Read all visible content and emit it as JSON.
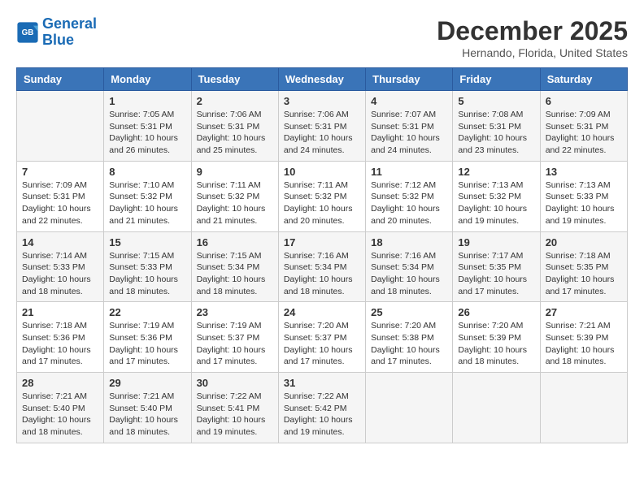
{
  "logo": {
    "line1": "General",
    "line2": "Blue"
  },
  "title": "December 2025",
  "subtitle": "Hernando, Florida, United States",
  "days_of_week": [
    "Sunday",
    "Monday",
    "Tuesday",
    "Wednesday",
    "Thursday",
    "Friday",
    "Saturday"
  ],
  "weeks": [
    [
      {
        "day": "",
        "content": ""
      },
      {
        "day": "1",
        "content": "Sunrise: 7:05 AM\nSunset: 5:31 PM\nDaylight: 10 hours\nand 26 minutes."
      },
      {
        "day": "2",
        "content": "Sunrise: 7:06 AM\nSunset: 5:31 PM\nDaylight: 10 hours\nand 25 minutes."
      },
      {
        "day": "3",
        "content": "Sunrise: 7:06 AM\nSunset: 5:31 PM\nDaylight: 10 hours\nand 24 minutes."
      },
      {
        "day": "4",
        "content": "Sunrise: 7:07 AM\nSunset: 5:31 PM\nDaylight: 10 hours\nand 24 minutes."
      },
      {
        "day": "5",
        "content": "Sunrise: 7:08 AM\nSunset: 5:31 PM\nDaylight: 10 hours\nand 23 minutes."
      },
      {
        "day": "6",
        "content": "Sunrise: 7:09 AM\nSunset: 5:31 PM\nDaylight: 10 hours\nand 22 minutes."
      }
    ],
    [
      {
        "day": "7",
        "content": "Sunrise: 7:09 AM\nSunset: 5:31 PM\nDaylight: 10 hours\nand 22 minutes."
      },
      {
        "day": "8",
        "content": "Sunrise: 7:10 AM\nSunset: 5:32 PM\nDaylight: 10 hours\nand 21 minutes."
      },
      {
        "day": "9",
        "content": "Sunrise: 7:11 AM\nSunset: 5:32 PM\nDaylight: 10 hours\nand 21 minutes."
      },
      {
        "day": "10",
        "content": "Sunrise: 7:11 AM\nSunset: 5:32 PM\nDaylight: 10 hours\nand 20 minutes."
      },
      {
        "day": "11",
        "content": "Sunrise: 7:12 AM\nSunset: 5:32 PM\nDaylight: 10 hours\nand 20 minutes."
      },
      {
        "day": "12",
        "content": "Sunrise: 7:13 AM\nSunset: 5:32 PM\nDaylight: 10 hours\nand 19 minutes."
      },
      {
        "day": "13",
        "content": "Sunrise: 7:13 AM\nSunset: 5:33 PM\nDaylight: 10 hours\nand 19 minutes."
      }
    ],
    [
      {
        "day": "14",
        "content": "Sunrise: 7:14 AM\nSunset: 5:33 PM\nDaylight: 10 hours\nand 18 minutes."
      },
      {
        "day": "15",
        "content": "Sunrise: 7:15 AM\nSunset: 5:33 PM\nDaylight: 10 hours\nand 18 minutes."
      },
      {
        "day": "16",
        "content": "Sunrise: 7:15 AM\nSunset: 5:34 PM\nDaylight: 10 hours\nand 18 minutes."
      },
      {
        "day": "17",
        "content": "Sunrise: 7:16 AM\nSunset: 5:34 PM\nDaylight: 10 hours\nand 18 minutes."
      },
      {
        "day": "18",
        "content": "Sunrise: 7:16 AM\nSunset: 5:34 PM\nDaylight: 10 hours\nand 18 minutes."
      },
      {
        "day": "19",
        "content": "Sunrise: 7:17 AM\nSunset: 5:35 PM\nDaylight: 10 hours\nand 17 minutes."
      },
      {
        "day": "20",
        "content": "Sunrise: 7:18 AM\nSunset: 5:35 PM\nDaylight: 10 hours\nand 17 minutes."
      }
    ],
    [
      {
        "day": "21",
        "content": "Sunrise: 7:18 AM\nSunset: 5:36 PM\nDaylight: 10 hours\nand 17 minutes."
      },
      {
        "day": "22",
        "content": "Sunrise: 7:19 AM\nSunset: 5:36 PM\nDaylight: 10 hours\nand 17 minutes."
      },
      {
        "day": "23",
        "content": "Sunrise: 7:19 AM\nSunset: 5:37 PM\nDaylight: 10 hours\nand 17 minutes."
      },
      {
        "day": "24",
        "content": "Sunrise: 7:20 AM\nSunset: 5:37 PM\nDaylight: 10 hours\nand 17 minutes."
      },
      {
        "day": "25",
        "content": "Sunrise: 7:20 AM\nSunset: 5:38 PM\nDaylight: 10 hours\nand 17 minutes."
      },
      {
        "day": "26",
        "content": "Sunrise: 7:20 AM\nSunset: 5:39 PM\nDaylight: 10 hours\nand 18 minutes."
      },
      {
        "day": "27",
        "content": "Sunrise: 7:21 AM\nSunset: 5:39 PM\nDaylight: 10 hours\nand 18 minutes."
      }
    ],
    [
      {
        "day": "28",
        "content": "Sunrise: 7:21 AM\nSunset: 5:40 PM\nDaylight: 10 hours\nand 18 minutes."
      },
      {
        "day": "29",
        "content": "Sunrise: 7:21 AM\nSunset: 5:40 PM\nDaylight: 10 hours\nand 18 minutes."
      },
      {
        "day": "30",
        "content": "Sunrise: 7:22 AM\nSunset: 5:41 PM\nDaylight: 10 hours\nand 19 minutes."
      },
      {
        "day": "31",
        "content": "Sunrise: 7:22 AM\nSunset: 5:42 PM\nDaylight: 10 hours\nand 19 minutes."
      },
      {
        "day": "",
        "content": ""
      },
      {
        "day": "",
        "content": ""
      },
      {
        "day": "",
        "content": ""
      }
    ]
  ]
}
